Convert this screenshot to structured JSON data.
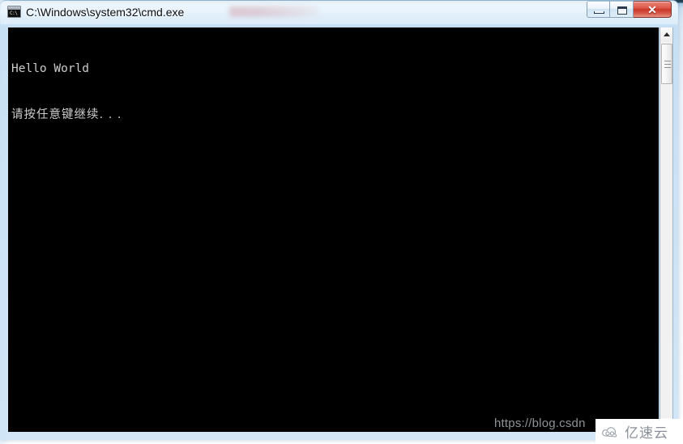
{
  "window": {
    "title": "C:\\Windows\\system32\\cmd.exe",
    "icon_name": "cmd-console-icon",
    "icon_prompt_text": "C:\\",
    "caption_buttons": {
      "minimize_label": "—",
      "maximize_label": "❐",
      "close_label": "✕"
    }
  },
  "console": {
    "background_color": "#000000",
    "text_color": "#cccccc",
    "lines": [
      "Hello World",
      "请按任意键继续. . ."
    ]
  },
  "scrollbar": {
    "up_arrow_name": "scroll-up-arrow",
    "down_arrow_name": "scroll-down-arrow",
    "thumb_name": "scrollbar-thumb"
  },
  "watermarks": {
    "blog_url": "https://blog.csdn",
    "site_badge_text": "亿速云",
    "site_badge_logo_name": "cloud-logo-icon"
  },
  "colors": {
    "accent_close_red": "#c9372a",
    "frame_glass_blue": "#cde4f6",
    "console_black": "#000000",
    "console_gray_text": "#cccccc",
    "badge_gray_text": "#8a9099"
  }
}
